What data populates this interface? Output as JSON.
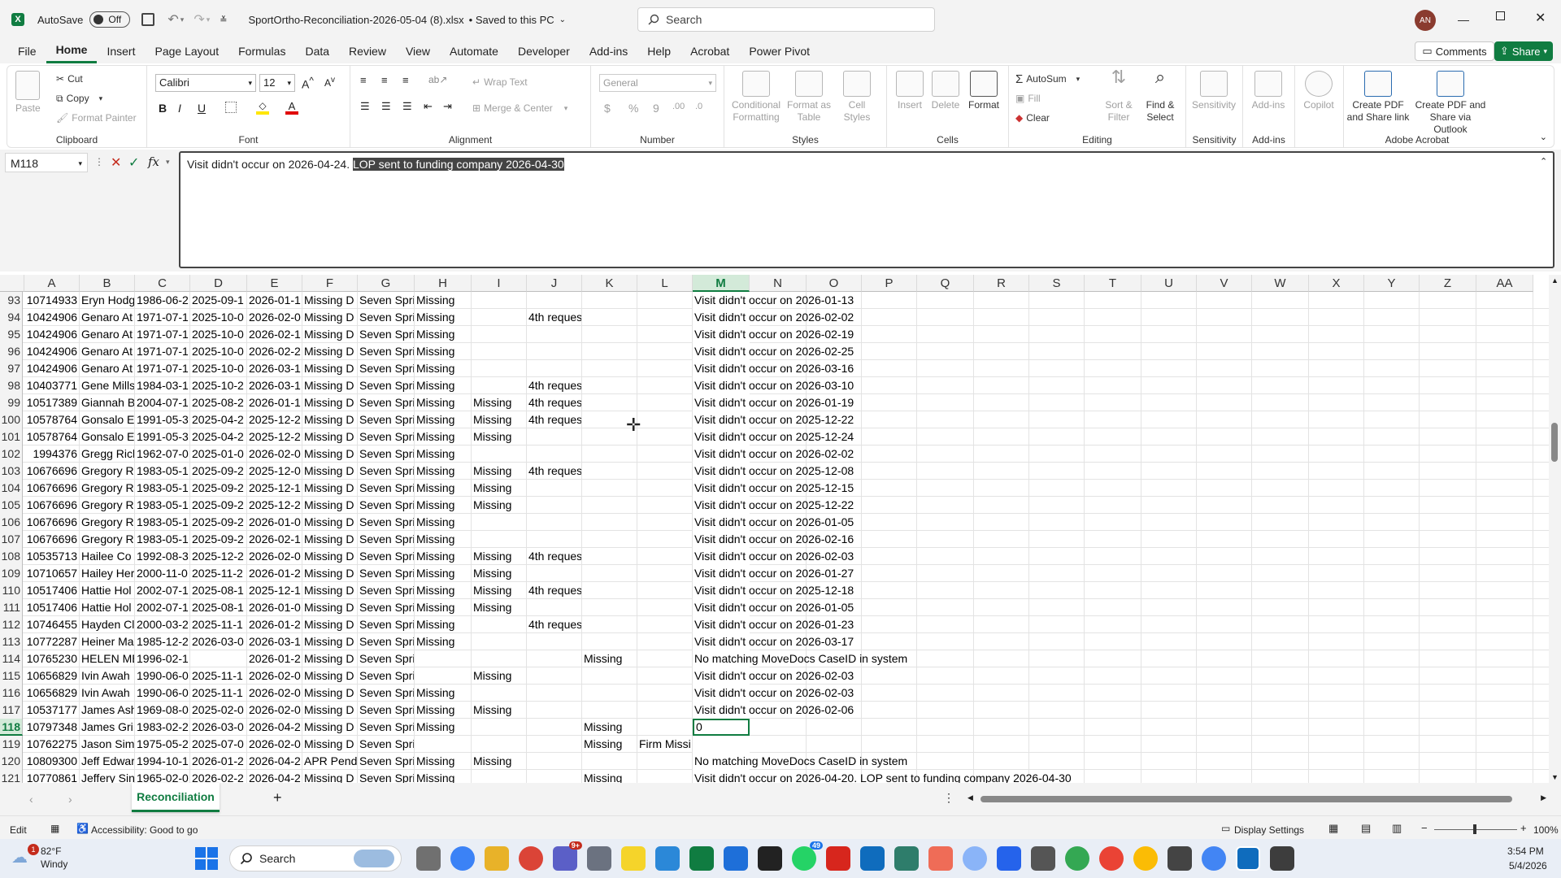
{
  "app": {
    "autosave_label": "AutoSave",
    "autosave_state": "Off",
    "filename": "SportOrtho-Reconciliation-2026-05-04 (8).xlsx",
    "saved_status": "•  Saved to this PC",
    "search_placeholder": "Search",
    "user_initials": "AN"
  },
  "menu": {
    "tabs": [
      "File",
      "Home",
      "Insert",
      "Page Layout",
      "Formulas",
      "Data",
      "Review",
      "View",
      "Automate",
      "Developer",
      "Add-ins",
      "Help",
      "Acrobat",
      "Power Pivot"
    ],
    "active": "Home",
    "comments": "Comments",
    "share": "Share"
  },
  "ribbon": {
    "clipboard": {
      "paste": "Paste",
      "cut": "Cut",
      "copy": "Copy",
      "format_painter": "Format Painter",
      "label": "Clipboard"
    },
    "font": {
      "name": "Calibri",
      "size": "12",
      "label": "Font",
      "bold": "B",
      "italic": "I",
      "underline": "U"
    },
    "alignment": {
      "wrap": "Wrap Text",
      "merge": "Merge & Center",
      "label": "Alignment"
    },
    "number": {
      "format": "General",
      "label": "Number",
      "currency": "$",
      "percent": "%",
      "comma": "9"
    },
    "styles": {
      "conditional": "Conditional Formatting",
      "format_table": "Format as Table",
      "cell_styles": "Cell Styles",
      "label": "Styles"
    },
    "cells": {
      "insert": "Insert",
      "delete": "Delete",
      "format": "Format",
      "label": "Cells"
    },
    "editing": {
      "autosum": "AutoSum",
      "fill": "Fill",
      "clear": "Clear",
      "sort": "Sort & Filter",
      "find": "Find & Select",
      "label": "Editing"
    },
    "sensitivity": {
      "btn": "Sensitivity",
      "label": "Sensitivity"
    },
    "addins": {
      "btn": "Add-ins",
      "label": "Add-ins"
    },
    "copilot": {
      "btn": "Copilot"
    },
    "acrobat": {
      "pdf_share": "Create PDF and Share link",
      "pdf_outlook": "Create PDF and Share via Outlook",
      "label": "Adobe Acrobat"
    }
  },
  "formula_bar": {
    "name_box": "M118",
    "formula_plain": "Visit didn't occur on 2026-04-24. ",
    "formula_selected": "LOP sent to funding company 2026-04-30"
  },
  "columns": [
    "A",
    "B",
    "C",
    "D",
    "E",
    "F",
    "G",
    "H",
    "I",
    "J",
    "K",
    "L",
    "M",
    "N",
    "O",
    "P",
    "Q",
    "R",
    "S",
    "T",
    "U",
    "V",
    "W",
    "X",
    "Y",
    "Z",
    "AA"
  ],
  "rows": [
    {
      "n": "93",
      "a": "10714933",
      "b": "Eryn Hodg",
      "c": "1986-06-2",
      "d": "2025-09-1",
      "e": "2026-01-1",
      "f": "Missing D",
      "g": "Seven Spri",
      "h": "Missing",
      "i": "",
      "j": "",
      "k": "",
      "l": "",
      "m": "Visit didn't occur on 2026-01-13"
    },
    {
      "n": "94",
      "a": "10424906",
      "b": "Genaro At",
      "c": "1971-07-1",
      "d": "2025-10-0",
      "e": "2026-02-0",
      "f": "Missing D",
      "g": "Seven Spri",
      "h": "Missing",
      "i": "",
      "j": "4th reques",
      "k": "",
      "l": "",
      "m": "Visit didn't occur on 2026-02-02"
    },
    {
      "n": "95",
      "a": "10424906",
      "b": "Genaro At",
      "c": "1971-07-1",
      "d": "2025-10-0",
      "e": "2026-02-1",
      "f": "Missing D",
      "g": "Seven Spri",
      "h": "Missing",
      "i": "",
      "j": "",
      "k": "",
      "l": "",
      "m": "Visit didn't occur on 2026-02-19"
    },
    {
      "n": "96",
      "a": "10424906",
      "b": "Genaro At",
      "c": "1971-07-1",
      "d": "2025-10-0",
      "e": "2026-02-2",
      "f": "Missing D",
      "g": "Seven Spri",
      "h": "Missing",
      "i": "",
      "j": "",
      "k": "",
      "l": "",
      "m": "Visit didn't occur on 2026-02-25"
    },
    {
      "n": "97",
      "a": "10424906",
      "b": "Genaro At",
      "c": "1971-07-1",
      "d": "2025-10-0",
      "e": "2026-03-1",
      "f": "Missing D",
      "g": "Seven Spri",
      "h": "Missing",
      "i": "",
      "j": "",
      "k": "",
      "l": "",
      "m": "Visit didn't occur on 2026-03-16"
    },
    {
      "n": "98",
      "a": "10403771",
      "b": "Gene Mills",
      "c": "1984-03-1",
      "d": "2025-10-2",
      "e": "2026-03-1",
      "f": "Missing D",
      "g": "Seven Spri",
      "h": "Missing",
      "i": "",
      "j": "4th reques",
      "k": "",
      "l": "",
      "m": "Visit didn't occur on 2026-03-10"
    },
    {
      "n": "99",
      "a": "10517389",
      "b": "Giannah B",
      "c": "2004-07-1",
      "d": "2025-08-2",
      "e": "2026-01-1",
      "f": "Missing D",
      "g": "Seven Spri",
      "h": "Missing",
      "i": "Missing",
      "j": "4th reques",
      "k": "",
      "l": "",
      "m": "Visit didn't occur on 2026-01-19"
    },
    {
      "n": "100",
      "a": "10578764",
      "b": "Gonsalo E",
      "c": "1991-05-3",
      "d": "2025-04-2",
      "e": "2025-12-2",
      "f": "Missing D",
      "g": "Seven Spri",
      "h": "Missing",
      "i": "Missing",
      "j": "4th reques",
      "k": "",
      "l": "",
      "m": "Visit didn't occur on 2025-12-22"
    },
    {
      "n": "101",
      "a": "10578764",
      "b": "Gonsalo E",
      "c": "1991-05-3",
      "d": "2025-04-2",
      "e": "2025-12-2",
      "f": "Missing D",
      "g": "Seven Spri",
      "h": "Missing",
      "i": "Missing",
      "j": "",
      "k": "",
      "l": "",
      "m": "Visit didn't occur on 2025-12-24"
    },
    {
      "n": "102",
      "a": "1994376",
      "b": "Gregg Ricl",
      "c": "1962-07-0",
      "d": "2025-01-0",
      "e": "2026-02-0",
      "f": "Missing D",
      "g": "Seven Spri",
      "h": "Missing",
      "i": "",
      "j": "",
      "k": "",
      "l": "",
      "m": "Visit didn't occur on 2026-02-02"
    },
    {
      "n": "103",
      "a": "10676696",
      "b": "Gregory Ri",
      "c": "1983-05-1",
      "d": "2025-09-2",
      "e": "2025-12-0",
      "f": "Missing D",
      "g": "Seven Spri",
      "h": "Missing",
      "i": "Missing",
      "j": "4th reques",
      "k": "",
      "l": "",
      "m": "Visit didn't occur on 2025-12-08"
    },
    {
      "n": "104",
      "a": "10676696",
      "b": "Gregory Ri",
      "c": "1983-05-1",
      "d": "2025-09-2",
      "e": "2025-12-1",
      "f": "Missing D",
      "g": "Seven Spri",
      "h": "Missing",
      "i": "Missing",
      "j": "",
      "k": "",
      "l": "",
      "m": "Visit didn't occur on 2025-12-15"
    },
    {
      "n": "105",
      "a": "10676696",
      "b": "Gregory Ri",
      "c": "1983-05-1",
      "d": "2025-09-2",
      "e": "2025-12-2",
      "f": "Missing D",
      "g": "Seven Spri",
      "h": "Missing",
      "i": "Missing",
      "j": "",
      "k": "",
      "l": "",
      "m": "Visit didn't occur on 2025-12-22"
    },
    {
      "n": "106",
      "a": "10676696",
      "b": "Gregory Ri",
      "c": "1983-05-1",
      "d": "2025-09-2",
      "e": "2026-01-0",
      "f": "Missing D",
      "g": "Seven Spri",
      "h": "Missing",
      "i": "",
      "j": "",
      "k": "",
      "l": "",
      "m": "Visit didn't occur on 2026-01-05"
    },
    {
      "n": "107",
      "a": "10676696",
      "b": "Gregory Ri",
      "c": "1983-05-1",
      "d": "2025-09-2",
      "e": "2026-02-1",
      "f": "Missing D",
      "g": "Seven Spri",
      "h": "Missing",
      "i": "",
      "j": "",
      "k": "",
      "l": "",
      "m": "Visit didn't occur on 2026-02-16"
    },
    {
      "n": "108",
      "a": "10535713",
      "b": "Hailee Co",
      "c": "1992-08-3",
      "d": "2025-12-2",
      "e": "2026-02-0",
      "f": "Missing D",
      "g": "Seven Spri",
      "h": "Missing",
      "i": "Missing",
      "j": "4th reques",
      "k": "",
      "l": "",
      "m": "Visit didn't occur on 2026-02-03"
    },
    {
      "n": "109",
      "a": "10710657",
      "b": "Hailey Her",
      "c": "2000-11-0",
      "d": "2025-11-2",
      "e": "2026-01-2",
      "f": "Missing D",
      "g": "Seven Spri",
      "h": "Missing",
      "i": "Missing",
      "j": "",
      "k": "",
      "l": "",
      "m": "Visit didn't occur on 2026-01-27"
    },
    {
      "n": "110",
      "a": "10517406",
      "b": "Hattie Hol",
      "c": "2002-07-1",
      "d": "2025-08-1",
      "e": "2025-12-1",
      "f": "Missing D",
      "g": "Seven Spri",
      "h": "Missing",
      "i": "Missing",
      "j": "4th reques",
      "k": "",
      "l": "",
      "m": "Visit didn't occur on 2025-12-18"
    },
    {
      "n": "111",
      "a": "10517406",
      "b": "Hattie Hol",
      "c": "2002-07-1",
      "d": "2025-08-1",
      "e": "2026-01-0",
      "f": "Missing D",
      "g": "Seven Spri",
      "h": "Missing",
      "i": "Missing",
      "j": "",
      "k": "",
      "l": "",
      "m": "Visit didn't occur on 2026-01-05"
    },
    {
      "n": "112",
      "a": "10746455",
      "b": "Hayden Cl",
      "c": "2000-03-2",
      "d": "2025-11-1",
      "e": "2026-01-2",
      "f": "Missing D",
      "g": "Seven Spri",
      "h": "Missing",
      "i": "",
      "j": "4th reques",
      "k": "",
      "l": "",
      "m": "Visit didn't occur on 2026-01-23"
    },
    {
      "n": "113",
      "a": "10772287",
      "b": "Heiner Ma",
      "c": "1985-12-2",
      "d": "2026-03-0",
      "e": "2026-03-1",
      "f": "Missing D",
      "g": "Seven Spri",
      "h": "Missing",
      "i": "",
      "j": "",
      "k": "",
      "l": "",
      "m": "Visit didn't occur on 2026-03-17"
    },
    {
      "n": "114",
      "a": "10765230",
      "b": "HELEN ME",
      "c": "1996-02-1",
      "d": "",
      "e": "2026-01-2",
      "f": "Missing D",
      "g": "Seven Spri",
      "h": "",
      "i": "",
      "j": "",
      "k": "Missing",
      "l": "",
      "m": "No matching MoveDocs CaseID in system"
    },
    {
      "n": "115",
      "a": "10656829",
      "b": "Ivin Awah",
      "c": "1990-06-0",
      "d": "2025-11-1",
      "e": "2026-02-0",
      "f": "Missing D",
      "g": "Seven Spri",
      "h": "",
      "i": "Missing",
      "j": "",
      "k": "",
      "l": "",
      "m": "Visit didn't occur on 2026-02-03"
    },
    {
      "n": "116",
      "a": "10656829",
      "b": "Ivin Awah",
      "c": "1990-06-0",
      "d": "2025-11-1",
      "e": "2026-02-0",
      "f": "Missing D",
      "g": "Seven Spri",
      "h": "Missing",
      "i": "",
      "j": "",
      "k": "",
      "l": "",
      "m": "Visit didn't occur on 2026-02-03"
    },
    {
      "n": "117",
      "a": "10537177",
      "b": "James Ash",
      "c": "1969-08-0",
      "d": "2025-02-0",
      "e": "2026-02-0",
      "f": "Missing D",
      "g": "Seven Spri",
      "h": "Missing",
      "i": "Missing",
      "j": "",
      "k": "",
      "l": "",
      "m": "Visit didn't occur on 2026-02-06"
    },
    {
      "n": "118",
      "a": "10797348",
      "b": "James Gri",
      "c": "1983-02-2",
      "d": "2026-03-0",
      "e": "2026-04-2",
      "f": "Missing D",
      "g": "Seven Spri",
      "h": "Missing",
      "i": "",
      "j": "",
      "k": "Missing",
      "l": "",
      "m": "0"
    },
    {
      "n": "119",
      "a": "10762275",
      "b": "Jason Sim",
      "c": "1975-05-2",
      "d": "2025-07-0",
      "e": "2026-02-0",
      "f": "Missing D",
      "g": "Seven Spri",
      "h": "",
      "i": "",
      "j": "",
      "k": "Missing",
      "l": "Firm Missi",
      "m": ""
    },
    {
      "n": "120",
      "a": "10809300",
      "b": "Jeff Edwar",
      "c": "1994-10-1",
      "d": "2026-01-2",
      "e": "2026-04-2",
      "f": "APR Pendi",
      "g": "Seven Spri",
      "h": "Missing",
      "i": "Missing",
      "j": "",
      "k": "",
      "l": "",
      "m": "No matching MoveDocs CaseID in system"
    },
    {
      "n": "121",
      "a": "10770861",
      "b": "Jeffery Sin",
      "c": "1965-02-0",
      "d": "2026-02-2",
      "e": "2026-04-2",
      "f": "Missing D",
      "g": "Seven Spri",
      "h": "Missing",
      "i": "",
      "j": "",
      "k": "Missing",
      "l": "",
      "m": "Visit didn't occur on 2026-04-20. LOP sent to funding company 2026-04-30"
    }
  ],
  "selected": {
    "row": "118",
    "col": "M"
  },
  "sheet_tab": "Reconciliation",
  "status": {
    "mode": "Edit",
    "accessibility": "Accessibility: Good to go",
    "display_settings": "Display Settings",
    "zoom": "100%"
  },
  "taskbar": {
    "weather_temp": "82°F",
    "weather_desc": "Windy",
    "weather_badge": "1",
    "search": "Search",
    "time": "3:54 PM",
    "date": "5/4/2026",
    "badge_a": "9+",
    "badge_b": "49"
  }
}
